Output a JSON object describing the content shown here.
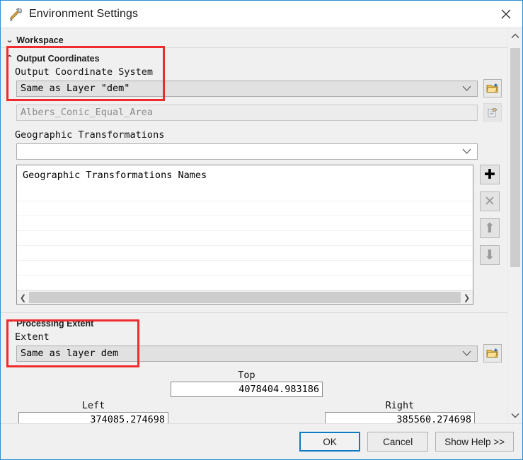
{
  "window": {
    "title": "Environment Settings",
    "icon": "tools-hammer-wrench-icon",
    "close_icon": "close-icon"
  },
  "sections": {
    "workspace": {
      "label": "Workspace",
      "state_icon": "chevron-double-down-icon"
    },
    "output_coordinates": {
      "label": "Output Coordinates",
      "state_icon": "chevron-double-up-icon"
    },
    "processing_extent": {
      "label": "Processing Extent",
      "state_icon": "chevron-double-up-icon"
    }
  },
  "output_coordinates": {
    "coord_system_label": "Output Coordinate System",
    "coord_system_value": "Same as Layer \"dem\"",
    "coord_system_browse_icon": "folder-add-icon",
    "projection_value": "Albers_Conic_Equal_Area",
    "projection_properties_icon": "properties-page-icon",
    "geo_transform_label": "Geographic Transformations",
    "geo_transform_value": "",
    "list_header": "Geographic Transformations Names",
    "list_rows": [
      "",
      "",
      "",
      "",
      "",
      "",
      "",
      ""
    ],
    "list_buttons": [
      {
        "name": "add-transformation-button",
        "glyph": "✚",
        "state": "enabled"
      },
      {
        "name": "remove-transformation-button",
        "glyph": "✕",
        "state": "disabled"
      },
      {
        "name": "move-up-button",
        "glyph": "⬆",
        "state": "disabled"
      },
      {
        "name": "move-down-button",
        "glyph": "⬇",
        "state": "disabled"
      }
    ],
    "hscroll_left_icon": "chevron-left-icon",
    "hscroll_right_icon": "chevron-right-icon"
  },
  "processing_extent": {
    "extent_label": "Extent",
    "extent_value": "Same as layer dem",
    "extent_browse_icon": "folder-add-icon",
    "top_label": "Top",
    "top_value": "4078404.983186",
    "left_label": "Left",
    "left_value": "374085.274698",
    "right_label": "Right",
    "right_value": "385560.274698"
  },
  "scrollbar": {
    "up_icon": "chevron-up-icon",
    "down_icon": "chevron-down-icon"
  },
  "footer": {
    "ok": "OK",
    "cancel": "Cancel",
    "help": "Show Help >>"
  },
  "annotations": {
    "accent_color": "#ef2b2b",
    "boxes": [
      "output-coordinates-highlight",
      "processing-extent-highlight"
    ]
  }
}
